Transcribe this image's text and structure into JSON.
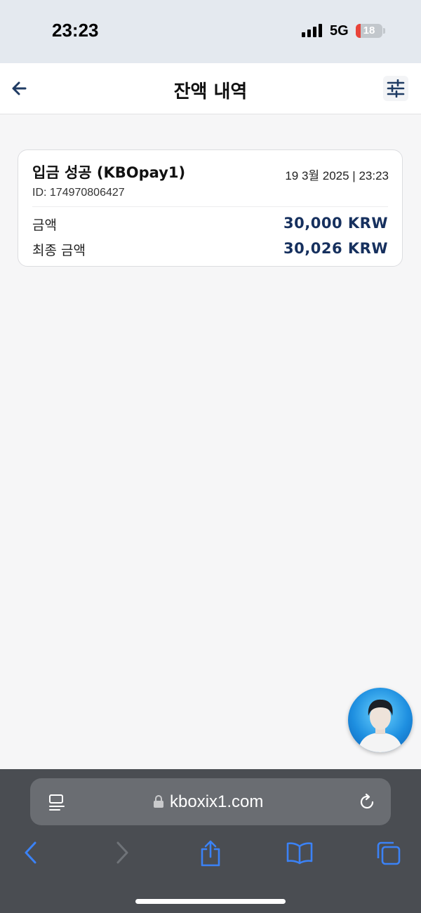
{
  "status_bar": {
    "time": "23:23",
    "network": "5G",
    "battery": "18",
    "battery_level": 0.18
  },
  "header": {
    "title": "잔액 내역",
    "back_icon": "arrow-left-icon",
    "filter_icon": "sliders-icon"
  },
  "transactions": [
    {
      "title": "입금 성공 (KBOpay1)",
      "datetime": "19 3월 2025 | 23:23",
      "id": "ID: 174970806427",
      "amount_label": "금액",
      "amount_value": "30,000 KRW",
      "final_label": "최종 금액",
      "final_value": "30,026 KRW"
    }
  ],
  "browser": {
    "url": "kboxix1.com",
    "icons": [
      "reader-icon",
      "lock-icon",
      "reload-icon",
      "back-icon",
      "forward-icon",
      "share-icon",
      "bookmarks-icon",
      "tabs-icon"
    ]
  },
  "colors": {
    "accent": "#16305e",
    "browser_icon": "#3b82f6",
    "status_bar_bg": "#e4e9ef",
    "browser_bg": "#4a4d52"
  }
}
